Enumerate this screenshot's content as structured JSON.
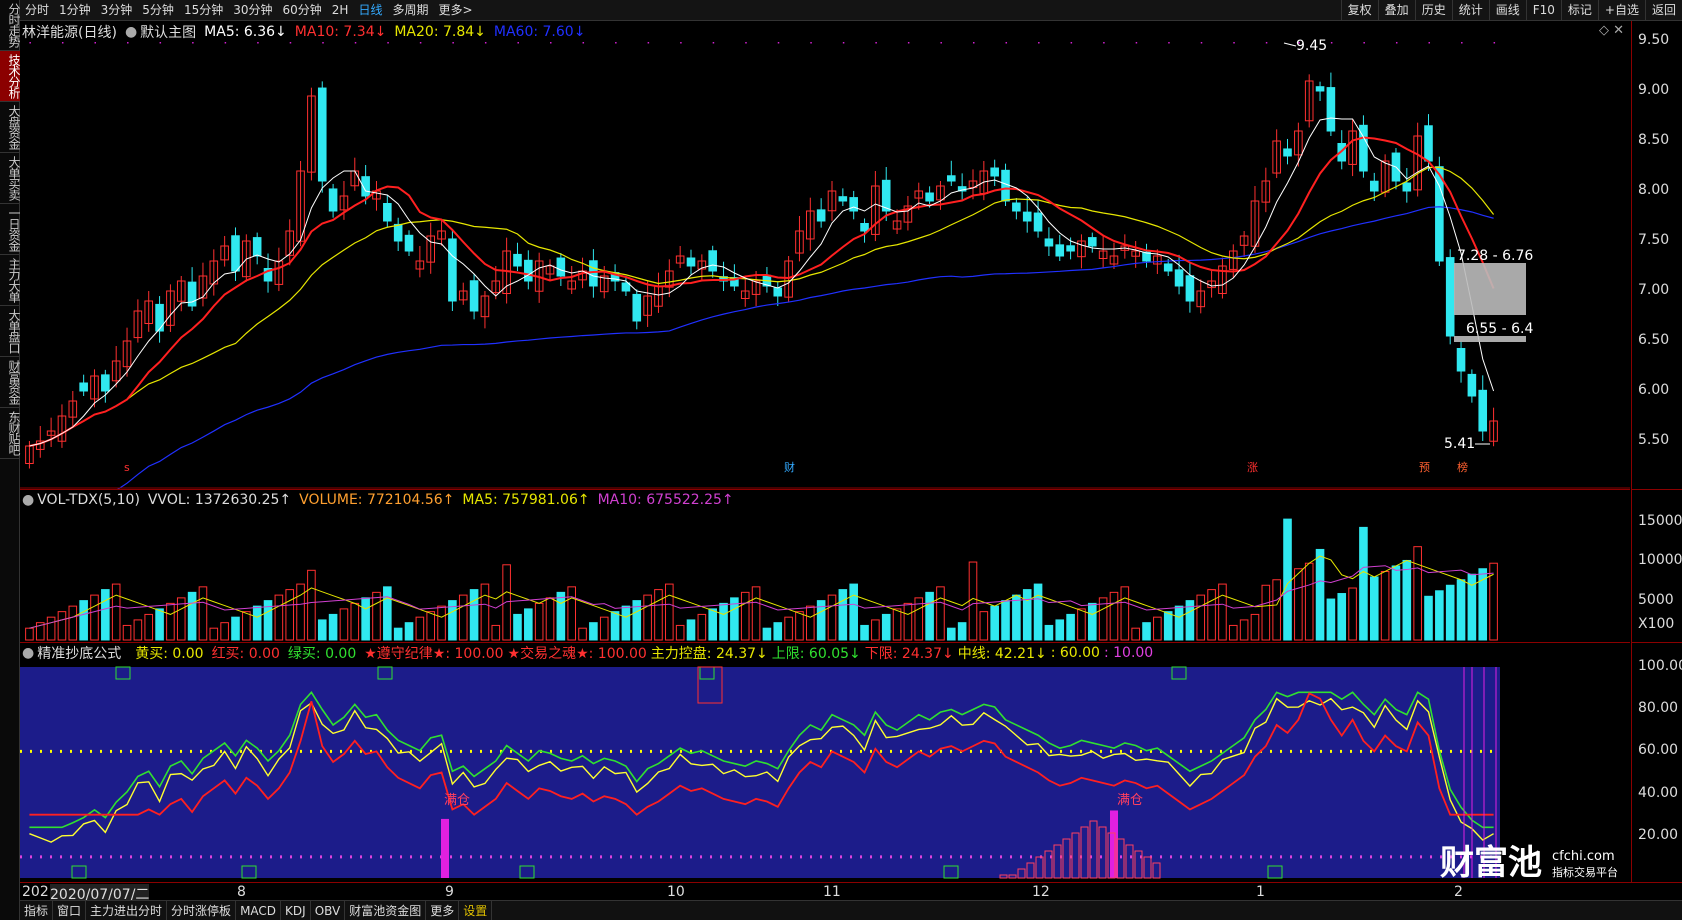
{
  "side_tabs": [
    "分时走势",
    "技术分析",
    "大盘资金",
    "大单买卖",
    "一日资金",
    "主力大单",
    "大单盘口",
    "财富资金",
    "东财贴吧"
  ],
  "toolbar": {
    "periods": [
      "分时",
      "1分钟",
      "3分钟",
      "5分钟",
      "15分钟",
      "30分钟",
      "60分钟",
      "2H",
      "日线",
      "多周期",
      "更多>"
    ],
    "active_period": "日线",
    "right": [
      "复权",
      "叠加",
      "历史",
      "统计",
      "画线",
      "F10",
      "标记",
      "+自选",
      "返回"
    ]
  },
  "main": {
    "stock": "林洋能源(日线)",
    "template": "默认主图",
    "ma5": "MA5: 6.36↓",
    "ma10": "MA10: 7.34↓",
    "ma20": "MA20: 7.84↓",
    "ma60": "MA60: 7.60↓",
    "colors": {
      "ma5": "#ffffff",
      "ma10": "#ff2020",
      "ma20": "#e6e600",
      "ma60": "#2030ff",
      "up": "#ff3030",
      "down": "#30e8f0"
    },
    "y_labels": [
      "9.50",
      "9.00",
      "8.50",
      "8.00",
      "7.50",
      "7.00",
      "6.50",
      "6.00",
      "5.50"
    ],
    "ylim": [
      5.3,
      9.6
    ],
    "high_label": "9.45",
    "low_label": "5.41",
    "gap1": "7.28 - 6.76",
    "gap2": "6.55 - 6.4",
    "markers": {
      "s": "s",
      "cai": "财",
      "zhang": "涨",
      "yu": "预",
      "bang": "榜"
    }
  },
  "volume": {
    "title": "VOL-TDX(5,10)",
    "vvol": "VVOL: 1372630.25↑",
    "volume": "VOLUME: 772104.56↑",
    "ma5": "MA5: 757981.06↑",
    "ma10": "MA10: 675522.25↑",
    "y_labels": [
      "15000",
      "10000",
      "5000",
      "X100"
    ],
    "ylim": [
      0,
      16000
    ]
  },
  "indicator": {
    "title": "精准抄底公式",
    "huang": "黄买: 0.00",
    "hong": "红买: 0.00",
    "lv": "绿买: 0.00",
    "zunshou": "★遵守纪律★: 100.00",
    "jiaoyi": "★交易之魂★: 100.00",
    "zhuli": "主力控盘: 24.37↓",
    "shangxian": "上限: 60.05↓",
    "xiaxian": "下限: 24.37↓",
    "zhongxian": "中线: 42.21↓",
    "v60": ": 60.00",
    "v10": ": 10.00",
    "y_labels": [
      "100.00",
      "80.00",
      "60.00",
      "40.00",
      "20.00"
    ],
    "mancang": "满仓",
    "mancang2": "满仓"
  },
  "xaxis": {
    "first": "202",
    "date": "2020/07/07/二",
    "months": [
      "8",
      "9",
      "10",
      "11",
      "12",
      "1",
      "2"
    ]
  },
  "bottom_tabs": [
    "指标",
    "窗口",
    "主力进出分时",
    "分时涨停板",
    "MACD",
    "KDJ",
    "OBV",
    "财富池资金图",
    "更多",
    "设置"
  ],
  "watermark": {
    "brand": "财富池",
    "site": "cfchi.com",
    "slogan": "指标交易平台"
  },
  "chart_data": {
    "type": "candlestick",
    "title": "林洋能源(日线)",
    "n": 132,
    "close": [
      5.45,
      5.5,
      5.6,
      5.75,
      5.9,
      6.0,
      6.15,
      6.0,
      6.3,
      6.5,
      6.8,
      6.9,
      6.6,
      7.0,
      7.1,
      6.85,
      7.15,
      7.3,
      7.45,
      7.2,
      7.5,
      7.35,
      7.1,
      7.3,
      7.6,
      8.2,
      8.95,
      8.1,
      7.8,
      7.95,
      8.2,
      7.95,
      8.0,
      7.7,
      7.5,
      7.4,
      7.3,
      7.55,
      7.6,
      6.9,
      7.0,
      6.8,
      6.95,
      7.1,
      7.4,
      7.25,
      7.1,
      7.3,
      7.25,
      7.15,
      7.1,
      7.2,
      7.05,
      7.15,
      7.1,
      7.0,
      6.7,
      6.95,
      7.05,
      7.2,
      7.35,
      7.25,
      7.3,
      7.2,
      7.1,
      7.05,
      7.0,
      7.1,
      7.05,
      6.95,
      7.3,
      7.6,
      7.8,
      7.7,
      8.0,
      7.9,
      7.8,
      7.6,
      8.05,
      7.8,
      7.7,
      7.85,
      8.0,
      7.9,
      8.05,
      8.1,
      8.0,
      8.1,
      8.2,
      8.15,
      7.9,
      7.8,
      7.7,
      7.6,
      7.45,
      7.35,
      7.4,
      7.5,
      7.45,
      7.4,
      7.35,
      7.45,
      7.4,
      7.3,
      7.35,
      7.2,
      7.05,
      6.9,
      7.0,
      7.1,
      7.25,
      7.4,
      7.55,
      7.9,
      8.1,
      8.5,
      8.35,
      8.6,
      9.1,
      9.0,
      8.6,
      8.3,
      8.6,
      8.2,
      8.0,
      8.3,
      8.1,
      8.0,
      8.55,
      8.3,
      7.3,
      6.55,
      6.2,
      5.95,
      5.6,
      5.7
    ],
    "series": [
      {
        "name": "MA5"
      },
      {
        "name": "MA10"
      },
      {
        "name": "MA20"
      },
      {
        "name": "MA60"
      }
    ]
  }
}
